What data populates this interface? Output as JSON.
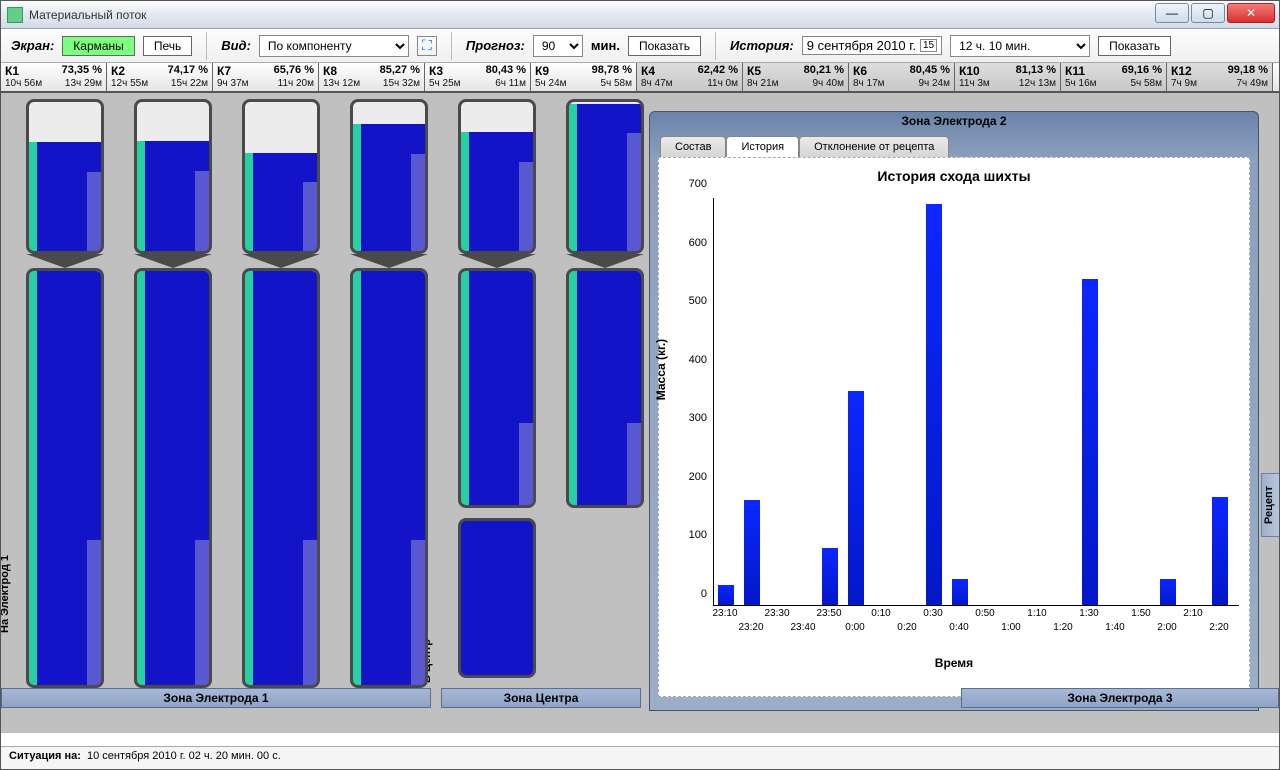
{
  "window_title": "Материальный поток",
  "toolbar": {
    "screen_label": "Экран:",
    "btn_pockets": "Карманы",
    "btn_furnace": "Печь",
    "view_label": "Вид:",
    "view_value": "По компоненту",
    "forecast_label": "Прогноз:",
    "forecast_value": "90",
    "forecast_unit": "мин.",
    "btn_show": "Показать",
    "history_label": "История:",
    "date_value": "9 сентября 2010 г.",
    "time_value": "12 ч. 10 мин.",
    "btn_show2": "Показать"
  },
  "columns": [
    {
      "name": "К1",
      "pct": "73,35 %",
      "t1": "10ч 56м",
      "t2": "13ч 29м",
      "dim": false
    },
    {
      "name": "К2",
      "pct": "74,17 %",
      "t1": "12ч 55м",
      "t2": "15ч 22м",
      "dim": false
    },
    {
      "name": "К7",
      "pct": "65,76 %",
      "t1": "9ч 37м",
      "t2": "11ч 20м",
      "dim": false
    },
    {
      "name": "К8",
      "pct": "85,27 %",
      "t1": "13ч 12м",
      "t2": "15ч 32м",
      "dim": false
    },
    {
      "name": "К3",
      "pct": "80,43 %",
      "t1": "5ч 25м",
      "t2": "6ч 11м",
      "dim": false
    },
    {
      "name": "К9",
      "pct": "98,78 %",
      "t1": "5ч 24м",
      "t2": "5ч 58м",
      "dim": false
    },
    {
      "name": "К4",
      "pct": "62,42 %",
      "t1": "8ч 47м",
      "t2": "11ч 0м",
      "dim": true
    },
    {
      "name": "К5",
      "pct": "80,21 %",
      "t1": "8ч 21м",
      "t2": "9ч 40м",
      "dim": true
    },
    {
      "name": "К6",
      "pct": "80,45 %",
      "t1": "8ч 17м",
      "t2": "9ч 24м",
      "dim": true
    },
    {
      "name": "К10",
      "pct": "81,13 %",
      "t1": "11ч 3м",
      "t2": "12ч 13м",
      "dim": true
    },
    {
      "name": "К11",
      "pct": "69,16 %",
      "t1": "5ч 16м",
      "t2": "5ч 58м",
      "dim": true
    },
    {
      "name": "К12",
      "pct": "99,18 %",
      "t1": "7ч 9м",
      "t2": "7ч 49м",
      "dim": true
    }
  ],
  "zones": {
    "z1": "Зона Электрода 1",
    "z2": "Зона Центра",
    "z3": "Зона Электрода 3"
  },
  "panel": {
    "title": "Зона Электрода 2",
    "tab_compose": "Состав",
    "tab_history": "История",
    "tab_dev": "Отклонение от рецепта"
  },
  "status": {
    "label": "Ситуация на:",
    "value": "10 сентября 2010 г.  02 ч. 20 мин. 00 с."
  },
  "sidetab": "Рецепт",
  "vlabels": {
    "left": "На Электрод 1",
    "center": "В Центр"
  },
  "chart_data": {
    "type": "bar",
    "title": "История схода шихты",
    "ylabel": "Масса (кг.)",
    "xlabel": "Время",
    "ylim": [
      0,
      700
    ],
    "yticks": [
      0,
      100,
      200,
      300,
      400,
      500,
      600,
      700
    ],
    "categories": [
      "23:10",
      "23:20",
      "23:30",
      "23:40",
      "23:50",
      "0:00",
      "0:10",
      "0:20",
      "0:30",
      "0:40",
      "0:50",
      "1:00",
      "1:10",
      "1:20",
      "1:30",
      "1:40",
      "1:50",
      "2:00",
      "2:10",
      "2:20"
    ],
    "values": [
      35,
      180,
      0,
      0,
      98,
      368,
      0,
      0,
      688,
      45,
      0,
      0,
      0,
      0,
      560,
      0,
      0,
      45,
      0,
      185
    ]
  },
  "silo_fills": {
    "K1": {
      "u": 73,
      "l": 100
    },
    "K2": {
      "u": 74,
      "l": 100
    },
    "K7": {
      "u": 66,
      "l": 100
    },
    "K8": {
      "u": 85,
      "l": 100
    },
    "K3": {
      "u": 80,
      "l": 100
    },
    "K9": {
      "u": 99,
      "l": 100
    }
  }
}
